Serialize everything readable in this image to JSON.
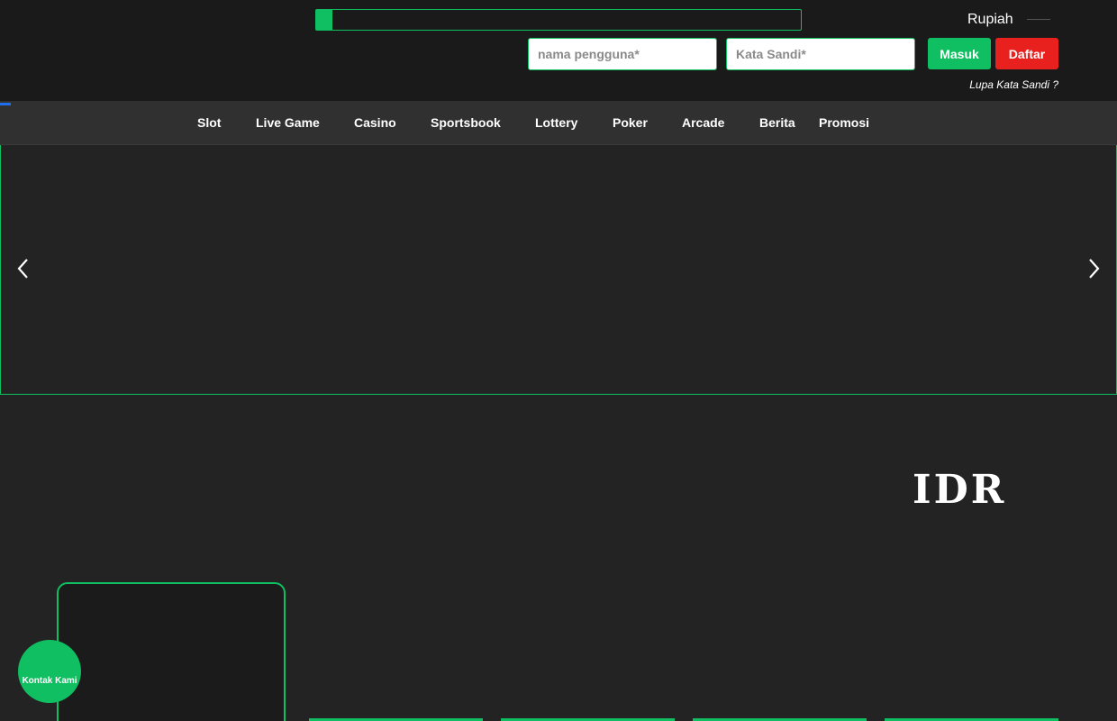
{
  "header": {
    "currency_label": "Rupiah",
    "username_placeholder": "nama pengguna*",
    "password_placeholder": "Kata Sandi*",
    "login_label": "Masuk",
    "register_label": "Daftar",
    "forgot_label": "Lupa Kata Sandi ?"
  },
  "nav": {
    "items": [
      {
        "label": "Slot"
      },
      {
        "label": "Live Game"
      },
      {
        "label": "Casino"
      },
      {
        "label": "Sportsbook"
      },
      {
        "label": "Lottery"
      },
      {
        "label": "Poker"
      },
      {
        "label": "Arcade"
      },
      {
        "label": "Berita"
      },
      {
        "label": "Promosi"
      }
    ]
  },
  "slider": {
    "prev_icon": "chevron-left-icon",
    "next_icon": "chevron-right-icon"
  },
  "main": {
    "currency_heading": "IDR"
  },
  "contact": {
    "label": "Kontak Kami"
  },
  "colors": {
    "accent": "#0fbf61",
    "danger": "#e8201e",
    "background": "#232323",
    "header": "#1a1a1a",
    "nav": "#303030"
  }
}
